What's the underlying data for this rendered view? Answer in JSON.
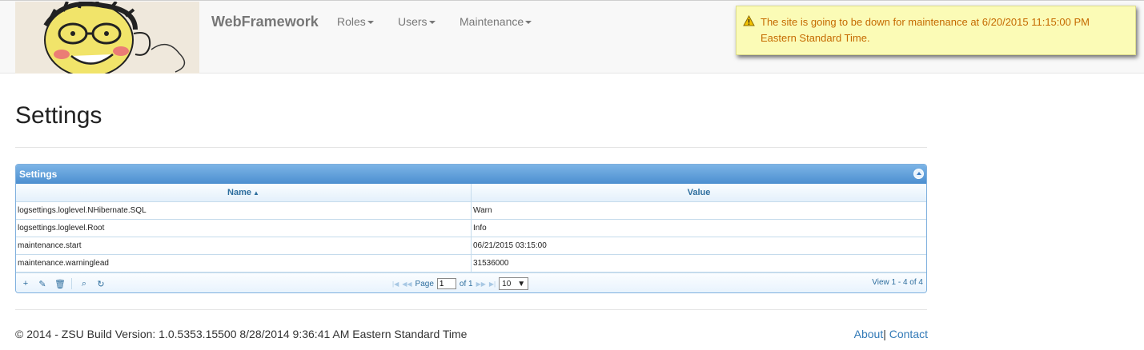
{
  "navbar": {
    "brand": "WebFramework",
    "menus": [
      {
        "label": "Roles"
      },
      {
        "label": "Users"
      },
      {
        "label": "Maintenance"
      }
    ]
  },
  "notice": {
    "icon": "warning-icon",
    "text": "The site is going to be down for maintenance at 6/20/2015 11:15:00 PM Eastern Standard Time."
  },
  "page": {
    "title": "Settings"
  },
  "grid": {
    "caption": "Settings",
    "columns": [
      {
        "label": "Name",
        "sort": "asc"
      },
      {
        "label": "Value"
      }
    ],
    "rows": [
      [
        "logsettings.loglevel.NHibernate.SQL",
        "Warn"
      ],
      [
        "logsettings.loglevel.Root",
        "Info"
      ],
      [
        "maintenance.start",
        "06/21/2015 03:15:00"
      ],
      [
        "maintenance.warninglead",
        "31536000"
      ]
    ],
    "pager": {
      "page_label": "Page",
      "page_value": "1",
      "of_label": "of 1",
      "rows_per_page": "10",
      "view_text": "View 1 - 4 of 4"
    }
  },
  "footer": {
    "text": "© 2014 - ZSU Build Version: 1.0.5353.15500 8/28/2014 9:36:41 AM Eastern Standard Time",
    "about": "About",
    "separator": "|",
    "contact": "Contact"
  }
}
